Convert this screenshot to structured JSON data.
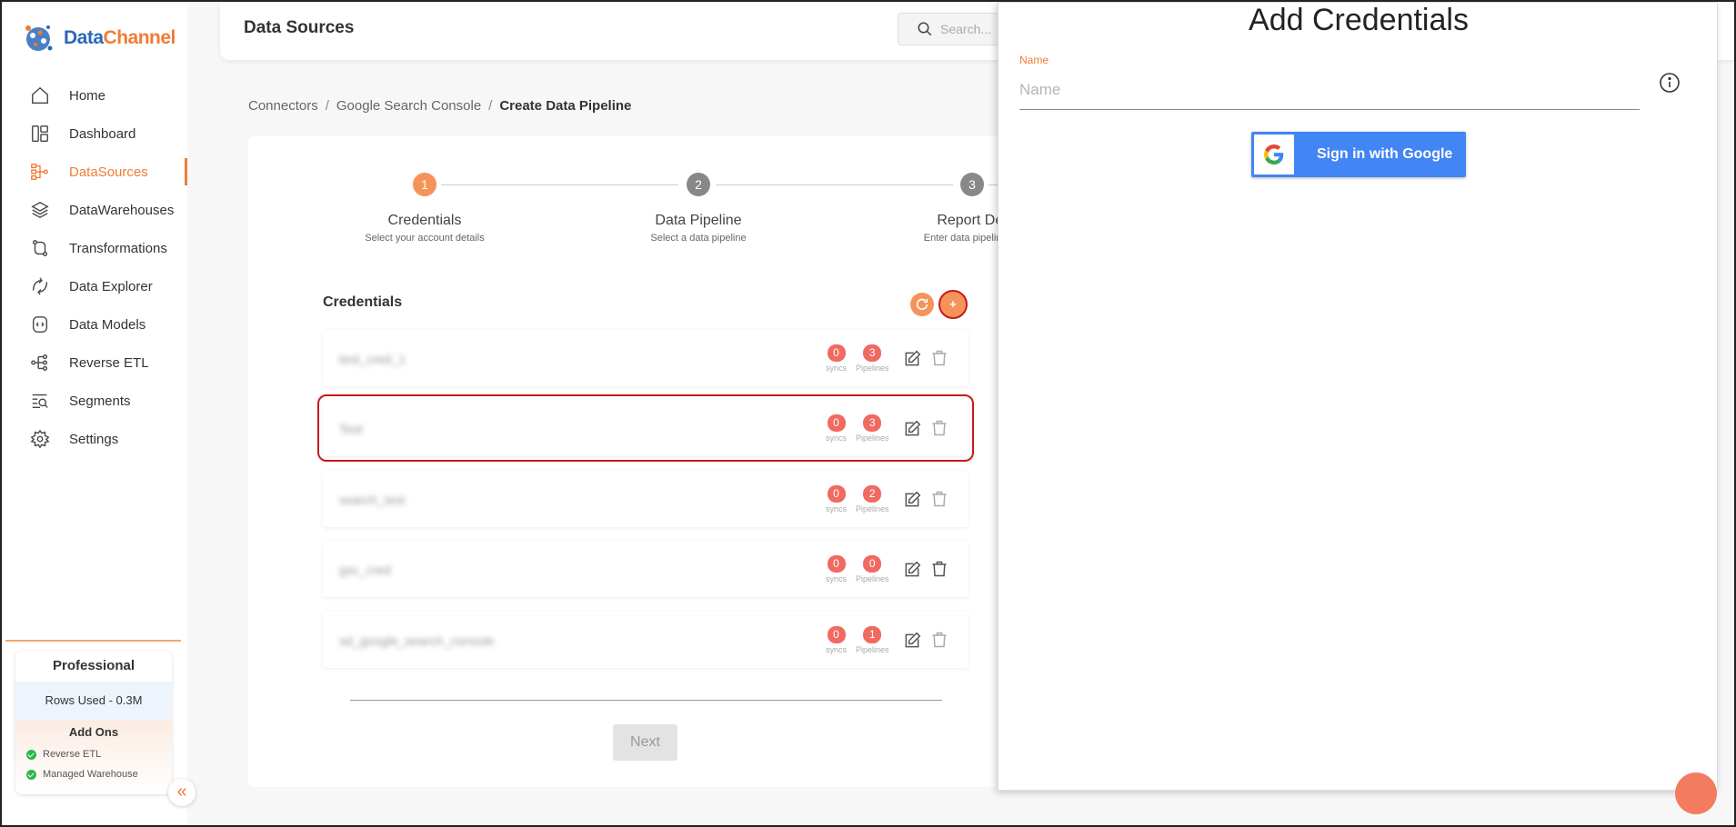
{
  "app": {
    "brand_part1": "Data",
    "brand_part2": "Channel"
  },
  "sidebar": {
    "items": [
      {
        "label": "Home",
        "icon": "home-icon"
      },
      {
        "label": "Dashboard",
        "icon": "dashboard-icon"
      },
      {
        "label": "DataSources",
        "icon": "datasources-icon",
        "active": true
      },
      {
        "label": "DataWarehouses",
        "icon": "layers-icon"
      },
      {
        "label": "Transformations",
        "icon": "transform-icon"
      },
      {
        "label": "Data Explorer",
        "icon": "explorer-icon"
      },
      {
        "label": "Data Models",
        "icon": "models-icon"
      },
      {
        "label": "Reverse ETL",
        "icon": "reverse-etl-icon"
      },
      {
        "label": "Segments",
        "icon": "segments-icon"
      },
      {
        "label": "Settings",
        "icon": "gear-icon"
      }
    ],
    "plan": {
      "title": "Professional",
      "rows_used": "Rows Used - 0.3M",
      "addons_title": "Add Ons",
      "addons": [
        "Reverse ETL",
        "Managed Warehouse"
      ]
    }
  },
  "header": {
    "title": "Data Sources",
    "search_placeholder": "Search..."
  },
  "breadcrumb": {
    "items": [
      "Connectors",
      "Google Search Console",
      "Create Data Pipeline"
    ],
    "sep": "/"
  },
  "stepper": {
    "steps": [
      {
        "number": "1",
        "title": "Credentials",
        "subtitle": "Select your account details"
      },
      {
        "number": "2",
        "title": "Data Pipeline",
        "subtitle": "Select a data pipeline"
      },
      {
        "number": "3",
        "title": "Report Det",
        "subtitle": "Enter data pipeline co"
      }
    ]
  },
  "credentials": {
    "heading": "Credentials",
    "add_label": "+",
    "syncs_label": "syncs",
    "pipelines_label": "Pipelines",
    "rows": [
      {
        "name": "test_cred_1",
        "syncs": "0",
        "pipelines": "3"
      },
      {
        "name": "Test",
        "syncs": "0",
        "pipelines": "3"
      },
      {
        "name": "search_test",
        "syncs": "0",
        "pipelines": "2"
      },
      {
        "name": "gsc_cred",
        "syncs": "0",
        "pipelines": "0"
      },
      {
        "name": "sd_google_search_console",
        "syncs": "0",
        "pipelines": "1"
      }
    ]
  },
  "footer": {
    "next_label": "Next"
  },
  "drawer": {
    "title": "Add Credentials",
    "name_label": "Name",
    "name_placeholder": "Name",
    "google_button_label": "Sign in with Google"
  },
  "colors": {
    "accent": "#f27b35",
    "badge": "#f06a62",
    "google_blue": "#4285f4",
    "highlight": "#c61a1a"
  }
}
